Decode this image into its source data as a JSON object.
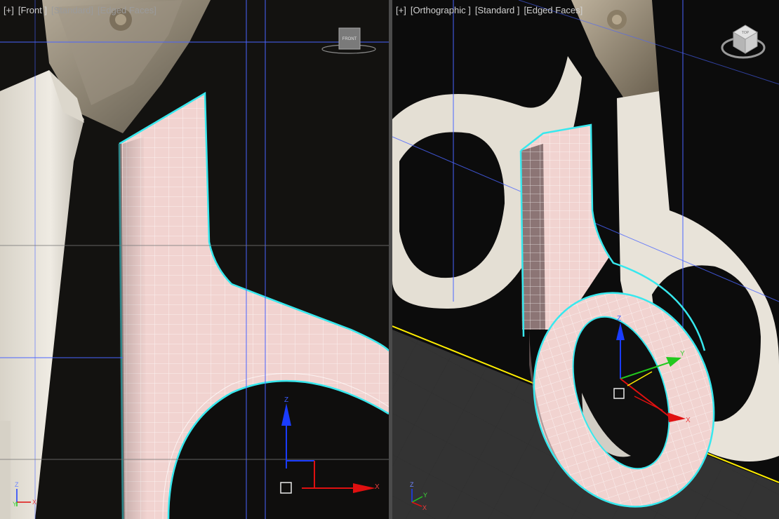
{
  "viewports": {
    "left": {
      "menu_label": "[+]",
      "view_label": "[Front ]",
      "shading_label": "[Standard]",
      "edged_label": "[Edged Faces]",
      "viewcube_label": "FRONT"
    },
    "right": {
      "menu_label": "[+]",
      "view_label": "[Orthographic ]",
      "shading_label": "[Standard ]",
      "edged_label": "[Edged Faces]",
      "viewcube_label": "TOP"
    }
  },
  "gizmo": {
    "x_label": "X",
    "y_label": "Y",
    "z_label": "Z"
  },
  "colors": {
    "mesh_fill": "#f1d3d0",
    "mesh_wire": "#ffffff",
    "selection_outline": "#37e8ee",
    "grid_line": "#4a64ff",
    "x_axis": "#e01010",
    "y_axis": "#22c81e",
    "z_axis": "#1a3cff",
    "horizon": "#ffee00"
  }
}
